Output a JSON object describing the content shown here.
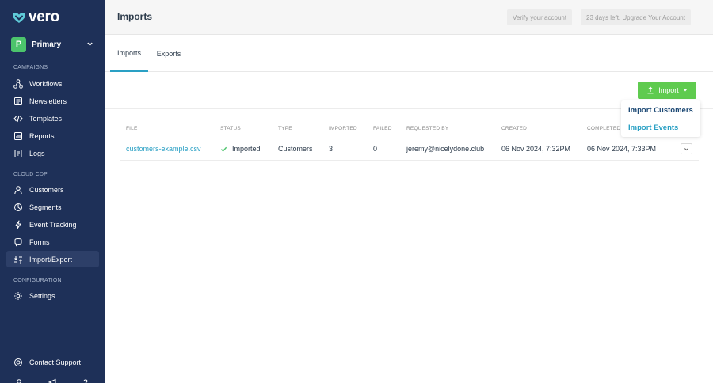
{
  "brand": {
    "name": "vero"
  },
  "workspace": {
    "initial": "P",
    "name": "Primary"
  },
  "sidebar": {
    "sections": [
      {
        "label": "CAMPAIGNS"
      },
      {
        "label": "CLOUD CDP"
      },
      {
        "label": "CONFIGURATION"
      }
    ],
    "items": [
      {
        "label": "Workflows",
        "icon": "workflows-icon"
      },
      {
        "label": "Newsletters",
        "icon": "newsletters-icon"
      },
      {
        "label": "Templates",
        "icon": "code-icon"
      },
      {
        "label": "Reports",
        "icon": "reports-icon"
      },
      {
        "label": "Logs",
        "icon": "logs-icon"
      },
      {
        "label": "Customers",
        "icon": "user-icon"
      },
      {
        "label": "Segments",
        "icon": "segments-icon"
      },
      {
        "label": "Event Tracking",
        "icon": "lightning-icon"
      },
      {
        "label": "Forms",
        "icon": "forms-icon"
      },
      {
        "label": "Import/Export",
        "icon": "import-export-icon",
        "active": true
      },
      {
        "label": "Settings",
        "icon": "gear-icon"
      }
    ],
    "support": {
      "label": "Contact Support",
      "icon": "support-icon"
    }
  },
  "header": {
    "title": "Imports",
    "verify_label": "Verify your account",
    "trial_label": "23 days left. Upgrade Your Account"
  },
  "tabs": [
    {
      "label": "Imports",
      "active": true
    },
    {
      "label": "Exports",
      "active": false
    }
  ],
  "toolbar": {
    "import_label": "Import",
    "dropdown": [
      {
        "label": "Import Customers"
      },
      {
        "label": "Import Events"
      }
    ]
  },
  "table": {
    "columns": [
      "FILE",
      "STATUS",
      "TYPE",
      "IMPORTED",
      "FAILED",
      "REQUESTED BY",
      "CREATED",
      "COMPLETED"
    ],
    "rows": [
      {
        "file": "customers-example.csv",
        "status": "Imported",
        "type": "Customers",
        "imported": "3",
        "failed": "0",
        "requested_by": "jeremy@nicelydone.club",
        "created": "06 Nov 2024, 7:32PM",
        "completed": "06 Nov 2024, 7:33PM"
      }
    ]
  },
  "colors": {
    "sidebar_bg": "#1e3058",
    "accent": "#2aa0c4",
    "import_button": "#5fcb4f",
    "status_ok": "#4cc46c"
  }
}
